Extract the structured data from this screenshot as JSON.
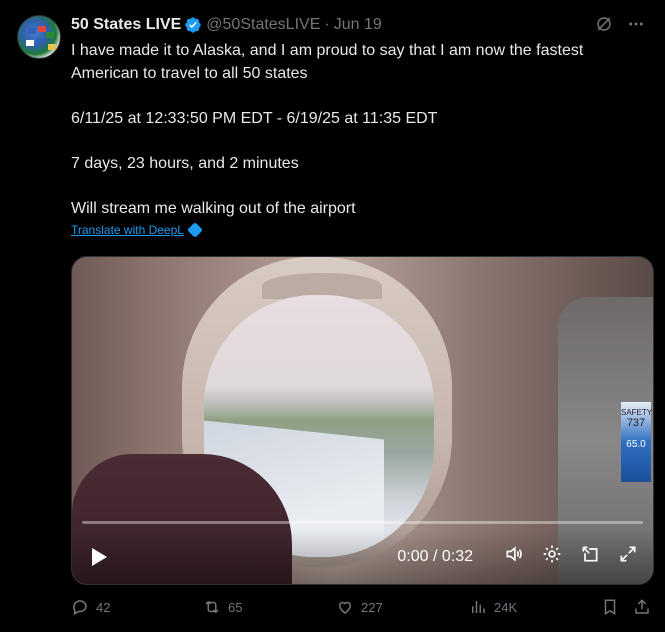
{
  "tweet": {
    "author_name": "50 States LIVE",
    "handle": "@50StatesLIVE",
    "separator": "·",
    "date": "Jun 19",
    "lines": [
      "I have made it to Alaska, and I am proud to say that I am now the fastest",
      "American to travel to all 50 states",
      "6/11/25 at 12:33:50 PM EDT - 6/19/25 at 11:35 EDT",
      "7 days, 23 hours, and 2 minutes",
      "Will stream me walking out of the airport"
    ],
    "translate_label": "Translate with DeepL"
  },
  "video": {
    "time": "0:00 / 0:32",
    "seatback_card_text": "SAFETY",
    "seatback_card_number": "737",
    "seatback_card_number2": "65.0"
  },
  "actions": {
    "replies": "42",
    "reposts": "65",
    "likes": "227",
    "views": "24K"
  },
  "colors": {
    "background": "#000000",
    "text": "#e7e9ea",
    "muted": "#71767b",
    "accent": "#1d9bf0"
  }
}
